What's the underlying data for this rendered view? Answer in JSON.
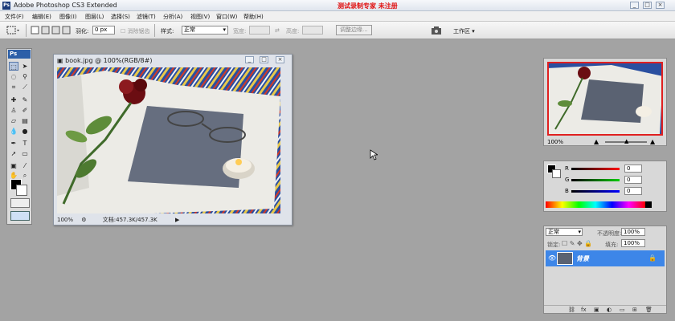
{
  "window": {
    "title": "Adobe Photoshop CS3 Extended",
    "watermark": "测试录制专家 未注册",
    "controls": [
      "_",
      "□",
      "×"
    ]
  },
  "menu": [
    "文件(F)",
    "编辑(E)",
    "图像(I)",
    "图层(L)",
    "选择(S)",
    "滤镜(T)",
    "分析(A)",
    "视图(V)",
    "窗口(W)",
    "帮助(H)"
  ],
  "options": {
    "feather_label": "羽化:",
    "feather_value": "0 px",
    "antialias_label": "消除锯齿",
    "style_label": "样式:",
    "style_value": "正常",
    "width_label": "宽度:",
    "height_label": "高度:",
    "refine_edge": "调整边缘...",
    "workspace": "工作区 ▾"
  },
  "toolbox": {
    "header": "Ps"
  },
  "document": {
    "title": "book.jpg @ 100%(RGB/8#)",
    "zoom": "100%",
    "doc_size": "文档:457.3K/457.3K",
    "controls": [
      "_",
      "□",
      "×"
    ]
  },
  "navigator": {
    "zoom": "100%"
  },
  "color_panel": {
    "channels": [
      {
        "label": "R",
        "value": "0"
      },
      {
        "label": "G",
        "value": "0"
      },
      {
        "label": "B",
        "value": "0"
      }
    ]
  },
  "layers": {
    "blend_mode": "正常",
    "opacity_label": "不透明度:",
    "opacity_value": "100%",
    "lock_label": "锁定:",
    "fill_label": "填充:",
    "fill_value": "100%",
    "layer_name": "背景"
  },
  "colors": {
    "accent": "#3d86e8",
    "watermark": "#e01010"
  }
}
